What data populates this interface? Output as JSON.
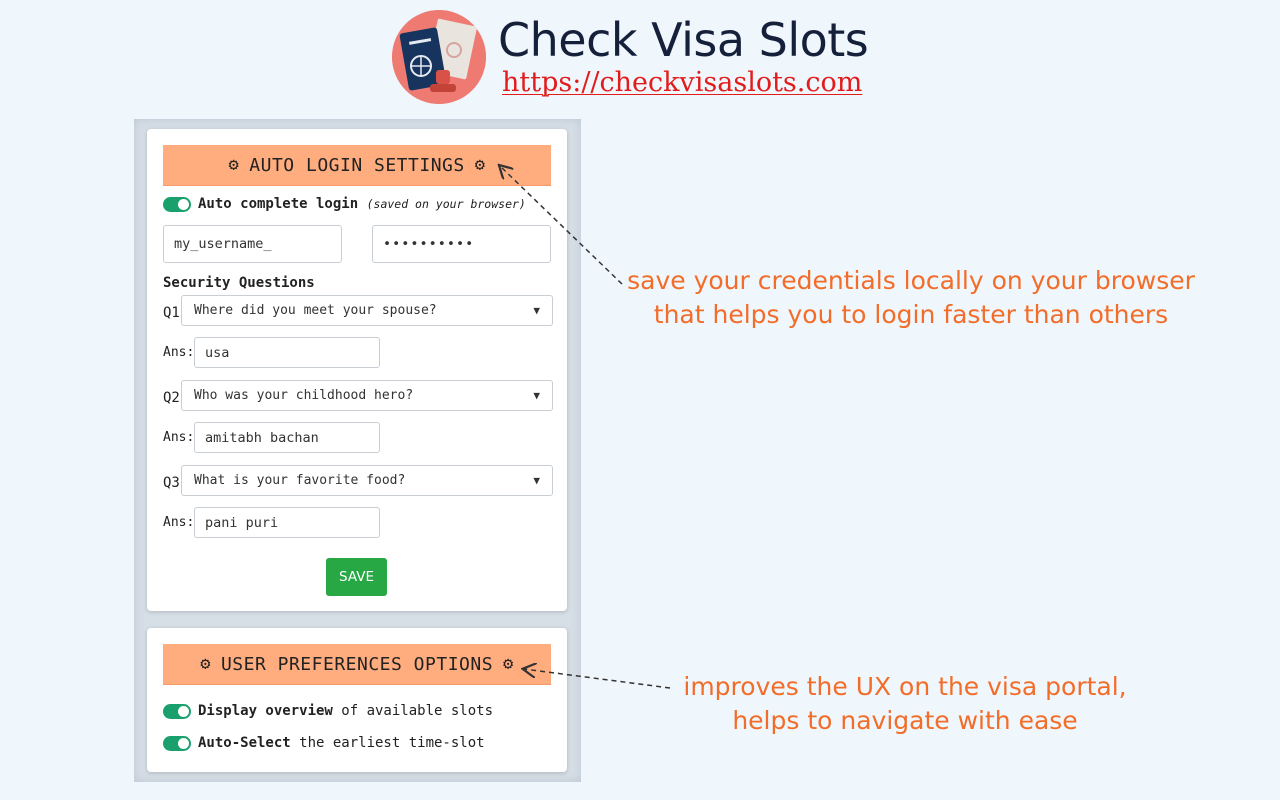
{
  "brand": {
    "title": "Check Visa Slots",
    "url": "https://checkvisaslots.com"
  },
  "auto_login": {
    "header": "AUTO LOGIN SETTINGS",
    "toggle_label_bold": "Auto complete login",
    "toggle_label_note": "(saved on your browser)",
    "toggle_on": true,
    "username": "my_username_",
    "password": "••••••••••",
    "security_heading": "Security Questions",
    "answer_label": "Ans:",
    "questions": [
      {
        "label": "Q1",
        "question": "Where did you meet your spouse?",
        "answer": "usa"
      },
      {
        "label": "Q2",
        "question": "Who was your childhood hero?",
        "answer": "amitabh bachan"
      },
      {
        "label": "Q3",
        "question": "What is your favorite food?",
        "answer": "pani puri"
      }
    ],
    "save_label": "SAVE"
  },
  "preferences": {
    "header": "USER PREFERENCES OPTIONS",
    "options": [
      {
        "bold": "Display overview",
        "rest": " of available slots",
        "on": true
      },
      {
        "bold": "Auto-Select",
        "rest": " the earliest time-slot",
        "on": true
      }
    ]
  },
  "annotations": {
    "login_note_line1": "save your credentials locally on your browser",
    "login_note_line2": "that helps you to login faster than others",
    "prefs_note_line1": "improves the UX on the visa portal,",
    "prefs_note_line2": "helps to navigate with ease"
  },
  "colors": {
    "header_bg": "#ffad7f",
    "toggle_on": "#1aa06d",
    "save_button": "#28a745",
    "annotation": "#f26d2a",
    "url": "#e21b1b"
  },
  "icons": {
    "header_icon": "gear-icon",
    "logo": "passport-logo"
  }
}
